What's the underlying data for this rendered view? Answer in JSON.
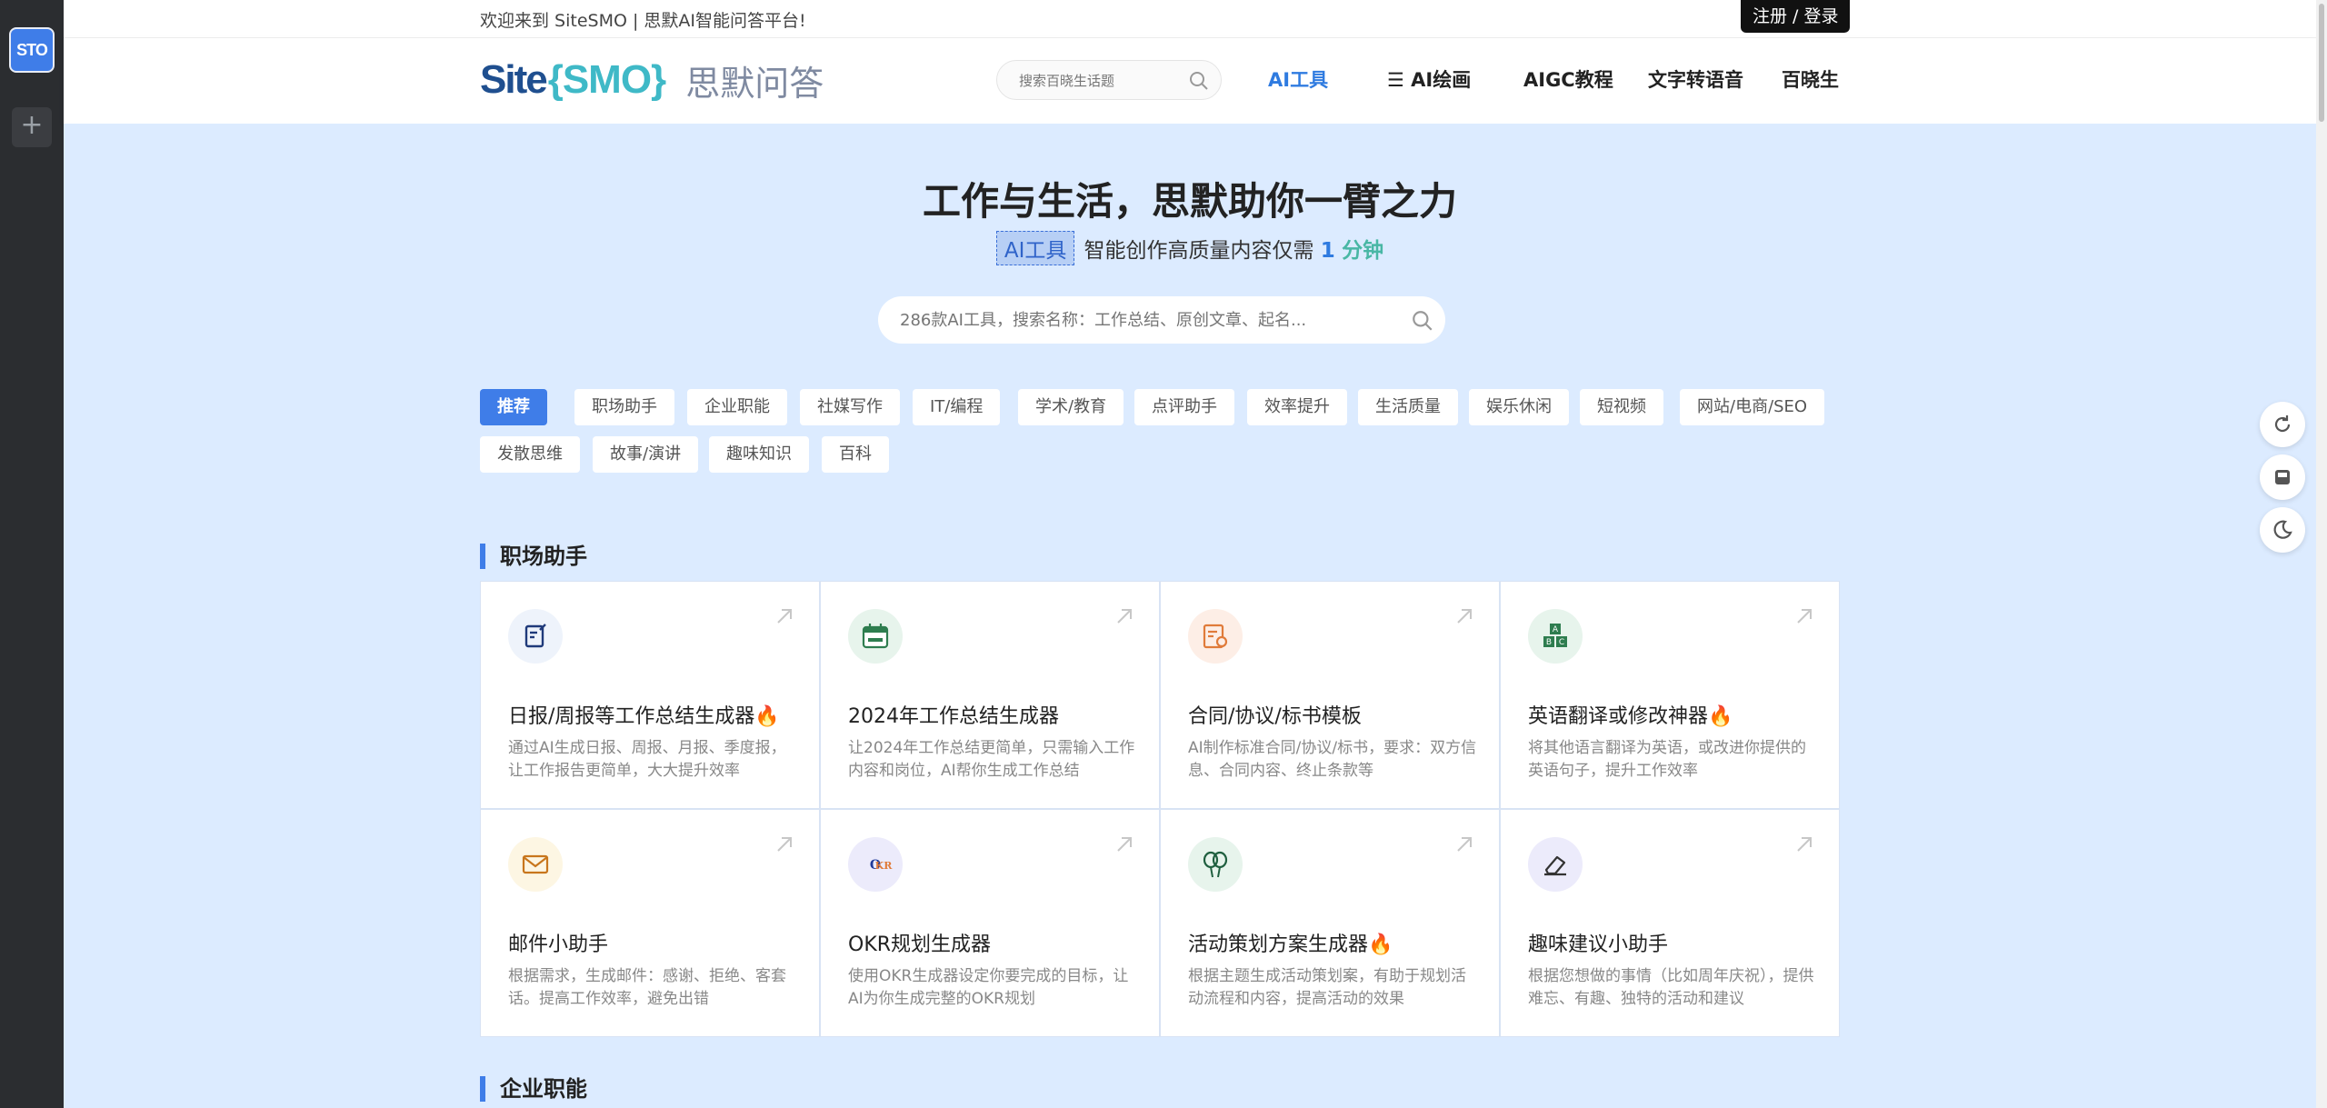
{
  "dock": {
    "app_label": "STO",
    "add_label": "+"
  },
  "topbar": {
    "welcome": "欢迎来到 SiteSMO | 思默AI智能问答平台!",
    "login": "注册 / 登录"
  },
  "header": {
    "logo_site": "Site",
    "logo_smo": "{SMO}",
    "logo_cn": "思默问答",
    "search_placeholder": "搜索百晓生话题",
    "nav": [
      {
        "label": "AI工具",
        "color": "#2f7be0"
      },
      {
        "label": "☰ AI绘画",
        "color": "#222222"
      },
      {
        "label": "AIGC教程",
        "color": "#222222"
      },
      {
        "label": "文字转语音",
        "color": "#222222"
      },
      {
        "label": "百晓生",
        "color": "#222222"
      }
    ]
  },
  "hero": {
    "title": "工作与生活，思默助你一臂之力",
    "tag": "AI工具",
    "subtitle": "智能创作高质量内容仅需",
    "num": "1",
    "unit": "分钟",
    "search_placeholder": "286款AI工具，搜索名称：工作总结、原创文章、起名..."
  },
  "categories": [
    "推荐",
    "职场助手",
    "企业职能",
    "社媒写作",
    "IT/编程",
    "学术/教育",
    "点评助手",
    "效率提升",
    "生活质量",
    "娱乐休闲",
    "短视频",
    "网站/电商/SEO",
    "发散思维",
    "故事/演讲",
    "趣味知识",
    "百科"
  ],
  "sections": [
    {
      "title": "职场助手",
      "cards": [
        {
          "icon": "edit-report-icon",
          "title": "日报/周报等工作总结生成器🔥",
          "desc": "通过AI生成日报、周报、月报、季度报，让工作报告更简单，大大提升效率"
        },
        {
          "icon": "calendar-2024-icon",
          "title": "2024年工作总结生成器",
          "desc": "让2024年工作总结更简单，只需输入工作内容和岗位，AI帮你生成工作总结"
        },
        {
          "icon": "contract-icon",
          "title": "合同/协议/标书模板",
          "desc": "AI制作标准合同/协议/标书，要求：双方信息、合同内容、终止条款等"
        },
        {
          "icon": "abc-blocks-icon",
          "title": "英语翻译或修改神器🔥",
          "desc": "将其他语言翻译为英语，或改进你提供的英语句子，提升工作效率"
        },
        {
          "icon": "mail-icon",
          "title": "邮件小助手",
          "desc": "根据需求，生成邮件：感谢、拒绝、客套话。提高工作效率，避免出错"
        },
        {
          "icon": "okr-icon",
          "title": "OKR规划生成器",
          "desc": "使用OKR生成器设定你要完成的目标，让AI为你生成完整的OKR规划"
        },
        {
          "icon": "balloons-icon",
          "title": "活动策划方案生成器🔥",
          "desc": "根据主题生成活动策划案，有助于规划活动流程和内容，提高活动的效果"
        },
        {
          "icon": "eraser-icon",
          "title": "趣味建议小助手",
          "desc": "根据您想做的事情（比如周年庆祝），提供难忘、有趣、独特的活动和建议"
        }
      ]
    },
    {
      "title": "企业职能"
    }
  ],
  "colors": {
    "accent": "#3f7de8",
    "hero_bg": "#dcebff"
  }
}
